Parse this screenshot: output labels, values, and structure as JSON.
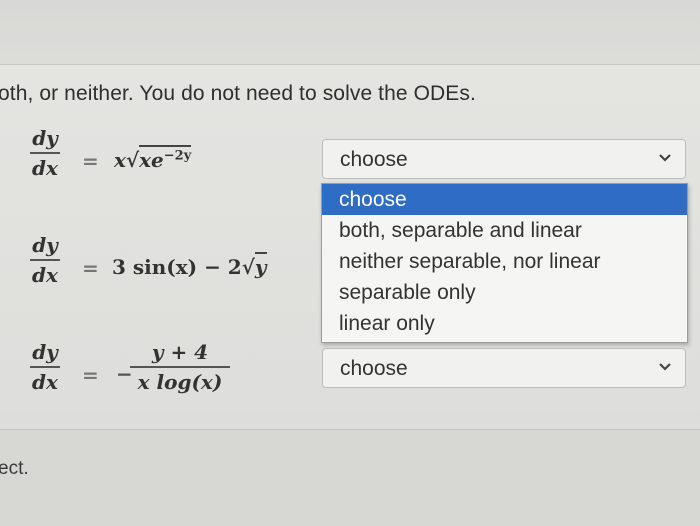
{
  "instruction": "oth, or neither. You do not need to solve the ODEs.",
  "questions": [
    {
      "lhs": {
        "num": "dy",
        "den": "dx"
      },
      "equals": "=",
      "rhs": {
        "prefix": "x",
        "sqrt": "xe",
        "exp": "−2y"
      },
      "select_value": "choose"
    },
    {
      "lhs": {
        "num": "dy",
        "den": "dx"
      },
      "equals": "=",
      "rhs": {
        "text": "3 sin(x) − 2",
        "sqrt": "y"
      }
    },
    {
      "lhs": {
        "num": "dy",
        "den": "dx"
      },
      "equals": "=",
      "rhs": {
        "sign": "−",
        "num": "y + 4",
        "den": "x log(x)"
      },
      "select_value": "choose"
    }
  ],
  "dropdown": {
    "options": [
      "choose",
      "both, separable and linear",
      "neither separable, nor linear",
      "separable only",
      "linear only"
    ],
    "highlighted": "choose",
    "highlight_color": "#2f6cc6"
  },
  "footer_text": "ect."
}
